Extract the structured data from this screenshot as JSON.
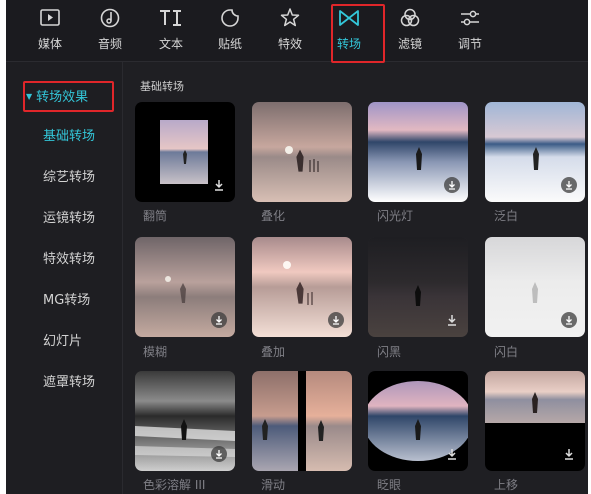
{
  "toolbar": {
    "items": [
      {
        "label": "媒体",
        "icon": "media-play-icon"
      },
      {
        "label": "音频",
        "icon": "audio-note-icon"
      },
      {
        "label": "文本",
        "icon": "text-ti-icon"
      },
      {
        "label": "贴纸",
        "icon": "sticker-icon"
      },
      {
        "label": "特效",
        "icon": "effects-star-icon"
      },
      {
        "label": "转场",
        "icon": "transition-bowtie-icon"
      },
      {
        "label": "滤镜",
        "icon": "filter-circles-icon"
      },
      {
        "label": "调节",
        "icon": "adjust-sliders-icon"
      }
    ],
    "active": "转场",
    "accent": "#33c6d8",
    "highlight_color": "#e0262a"
  },
  "sidebar": {
    "header": "转场效果",
    "items": [
      "基础转场",
      "综艺转场",
      "运镜转场",
      "特效转场",
      "MG转场",
      "幻灯片",
      "遮罩转场"
    ],
    "active": "基础转场"
  },
  "main": {
    "section_title": "基础转场",
    "cards": [
      "翻筒",
      "叠化",
      "闪光灯",
      "泛白",
      "模糊",
      "叠加",
      "闪黑",
      "闪白",
      "色彩溶解 III",
      "滑动",
      "眨眼",
      "上移"
    ]
  }
}
